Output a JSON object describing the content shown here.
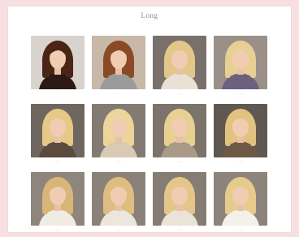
{
  "page": {
    "title": "Long",
    "subtitle": "···"
  },
  "gallery": [
    {
      "caption": "·····",
      "photo": "portrait-photo",
      "bg": "#d8d3cf",
      "hair": "#4a2516",
      "top": "#2b1a14"
    },
    {
      "caption": "·····",
      "photo": "portrait-photo",
      "bg": "#c8b8a8",
      "hair": "#8a4a26",
      "top": "#9b9b9b"
    },
    {
      "caption": "······",
      "photo": "portrait-photo",
      "bg": "#7a706b",
      "hair": "#e3c68a",
      "top": "#e9e1d5"
    },
    {
      "caption": "······",
      "photo": "portrait-photo",
      "bg": "#9a9088",
      "hair": "#e8cf93",
      "top": "#6d5f7e"
    },
    {
      "caption": "······",
      "photo": "portrait-photo",
      "bg": "#6e665f",
      "hair": "#e6c987",
      "top": "#5b4a3e"
    },
    {
      "caption": "······",
      "photo": "portrait-photo",
      "bg": "#837a72",
      "hair": "#ecd59a",
      "top": "#d9cab5"
    },
    {
      "caption": "······",
      "photo": "portrait-photo",
      "bg": "#7c736b",
      "hair": "#e8cf92",
      "top": "#a99a87"
    },
    {
      "caption": "······",
      "photo": "portrait-photo",
      "bg": "#5f5852",
      "hair": "#e2c27f",
      "top": "#6c5a46"
    },
    {
      "caption": "······",
      "photo": "portrait-photo",
      "bg": "#8e857c",
      "hair": "#d9b678",
      "top": "#f1ece3"
    },
    {
      "caption": "······",
      "photo": "portrait-photo",
      "bg": "#8a8178",
      "hair": "#dfbd80",
      "top": "#ede6dc"
    },
    {
      "caption": "······",
      "photo": "portrait-photo",
      "bg": "#857c73",
      "hair": "#e4c68a",
      "top": "#eae3d8"
    },
    {
      "caption": "······",
      "photo": "portrait-photo",
      "bg": "#8c847b",
      "hair": "#e7cb8d",
      "top": "#f4f0ea"
    }
  ]
}
